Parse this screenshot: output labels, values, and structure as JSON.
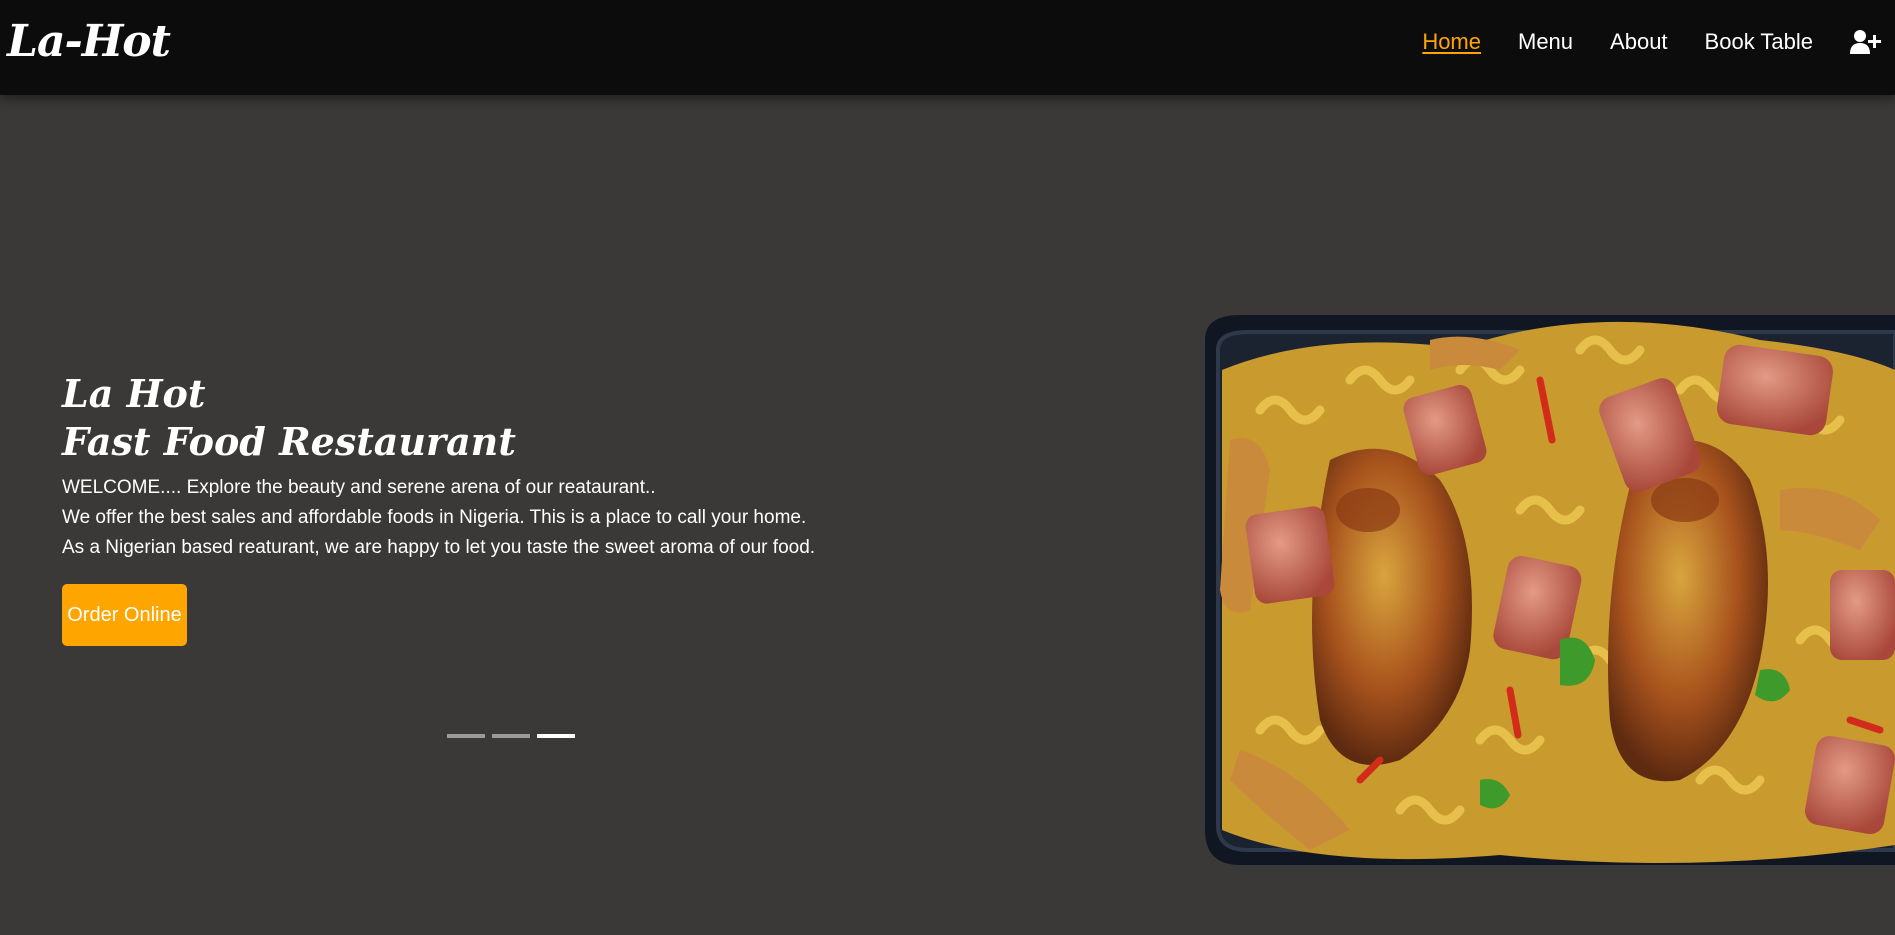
{
  "header": {
    "brand": "La-Hot",
    "nav": [
      {
        "label": "Home",
        "active": true
      },
      {
        "label": "Menu",
        "active": false
      },
      {
        "label": "About",
        "active": false
      },
      {
        "label": "Book Table",
        "active": false
      }
    ],
    "user_icon": "user-plus-icon"
  },
  "hero": {
    "title_line1": "La Hot",
    "title_line2": "Fast Food Restaurant",
    "text_lines": [
      "WELCOME.... Explore the beauty and serene arena of our reataurant..",
      "We offer the best sales and affordable foods in Nigeria. This is a place to call your home.",
      "As a Nigerian based reaturant, we are happy to let you taste the sweet aroma of our food."
    ],
    "cta_label": "Order Online",
    "slides": {
      "count": 3,
      "active_index": 2
    },
    "image": "pasta-chicken-sausage-tray"
  },
  "colors": {
    "accent": "#ffa500",
    "header_bg": "#0c0c0c",
    "hero_bg": "#3a3938"
  }
}
